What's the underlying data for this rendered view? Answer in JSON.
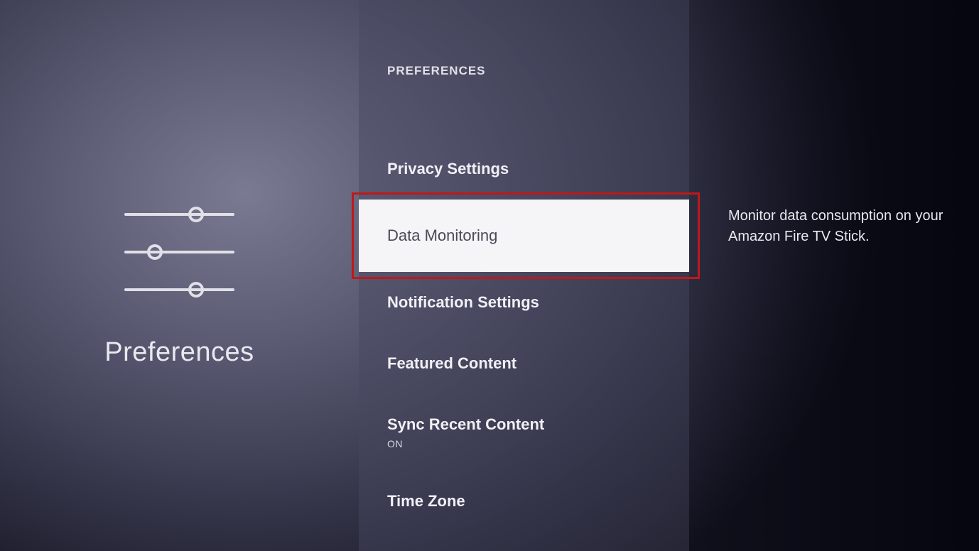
{
  "leftPanel": {
    "title": "Preferences"
  },
  "sectionHeader": "PREFERENCES",
  "menu": {
    "items": [
      {
        "label": "Privacy Settings",
        "subvalue": null,
        "selected": false
      },
      {
        "label": "Data Monitoring",
        "subvalue": null,
        "selected": true
      },
      {
        "label": "Notification Settings",
        "subvalue": null,
        "selected": false
      },
      {
        "label": "Featured Content",
        "subvalue": null,
        "selected": false
      },
      {
        "label": "Sync Recent Content",
        "subvalue": "ON",
        "selected": false
      },
      {
        "label": "Time Zone",
        "subvalue": null,
        "selected": false
      }
    ]
  },
  "description": "Monitor data consumption on your Amazon Fire TV Stick."
}
